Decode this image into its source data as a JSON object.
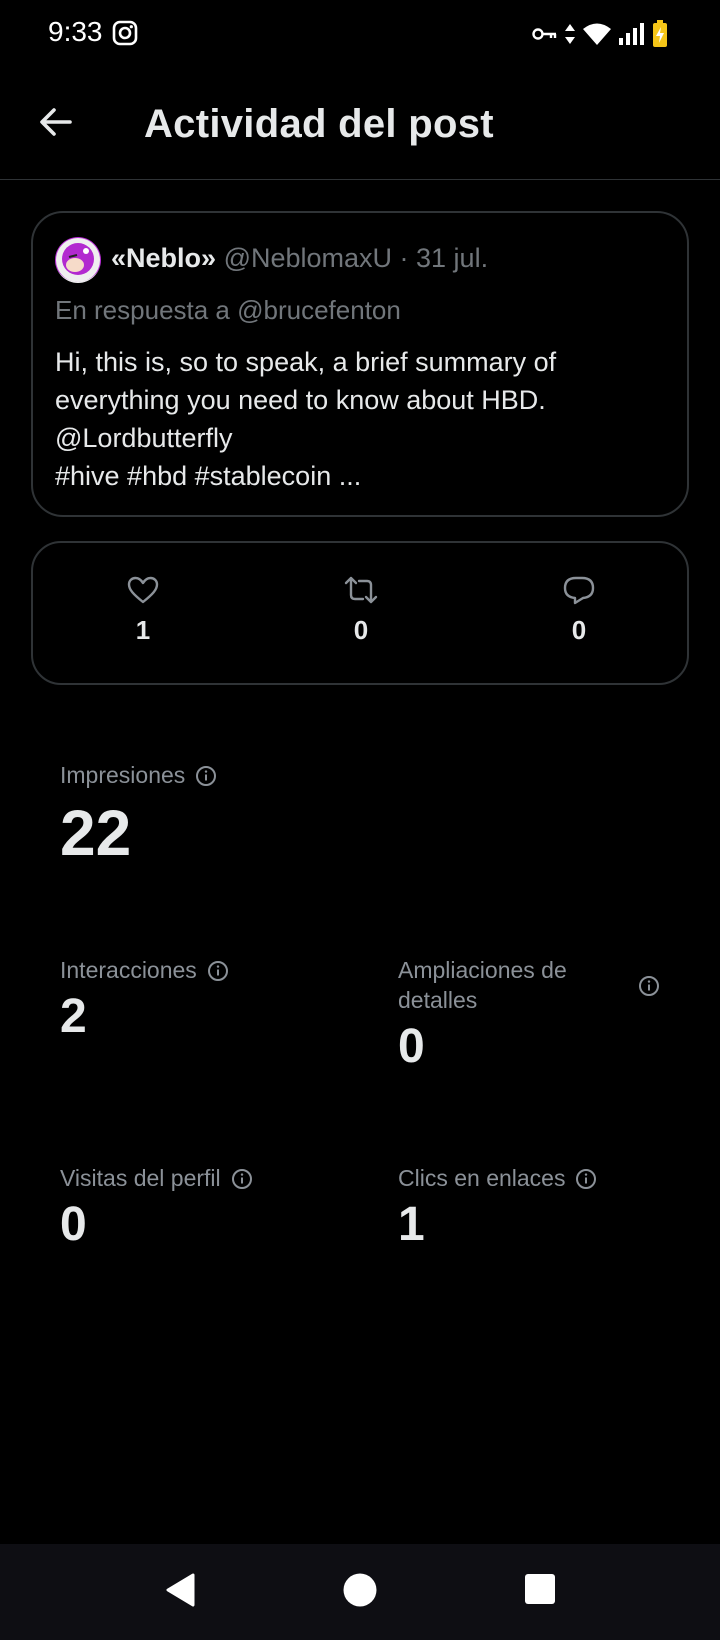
{
  "status_bar": {
    "time": "9:33",
    "icons": [
      "instagram-icon",
      "vpn-key-icon",
      "data-arrows-icon",
      "wifi-icon",
      "signal-icon",
      "battery-charging-icon"
    ],
    "battery_color": "#f5c518"
  },
  "header": {
    "back_icon": "arrow-left-icon",
    "title": "Actividad del post"
  },
  "post": {
    "author_name": "«Neblo»",
    "handle_date": "@NeblomaxU · 31 jul.",
    "reply_to": "En respuesta a @brucefenton",
    "text_lines": [
      "Hi, this is, so to speak, a brief summary of",
      "everything you need to know about HBD.",
      "@Lordbutterfly",
      "#hive #hbd #stablecoin ..."
    ]
  },
  "engagement": {
    "likes": {
      "icon": "heart-icon",
      "count": "1"
    },
    "reposts": {
      "icon": "repost-icon",
      "count": "0"
    },
    "replies": {
      "icon": "reply-icon",
      "count": "0"
    }
  },
  "metrics": {
    "impressions": {
      "label": "Impresiones",
      "value": "22"
    },
    "interactions": {
      "label": "Interacciones",
      "value": "2"
    },
    "detail_expands": {
      "label_line1": "Ampliaciones de",
      "label_line2": "detalles",
      "value": "0"
    },
    "profile_visits": {
      "label": "Visitas del perfil",
      "value": "0"
    },
    "link_clicks": {
      "label": "Clics en enlaces",
      "value": "1"
    }
  },
  "nav_bar": {
    "icons": [
      "back-triangle-icon",
      "home-circle-icon",
      "recents-square-icon"
    ]
  },
  "colors": {
    "background": "#000000",
    "text_primary": "#e7e9ea",
    "text_secondary": "#71767b",
    "border": "#2f3336"
  }
}
